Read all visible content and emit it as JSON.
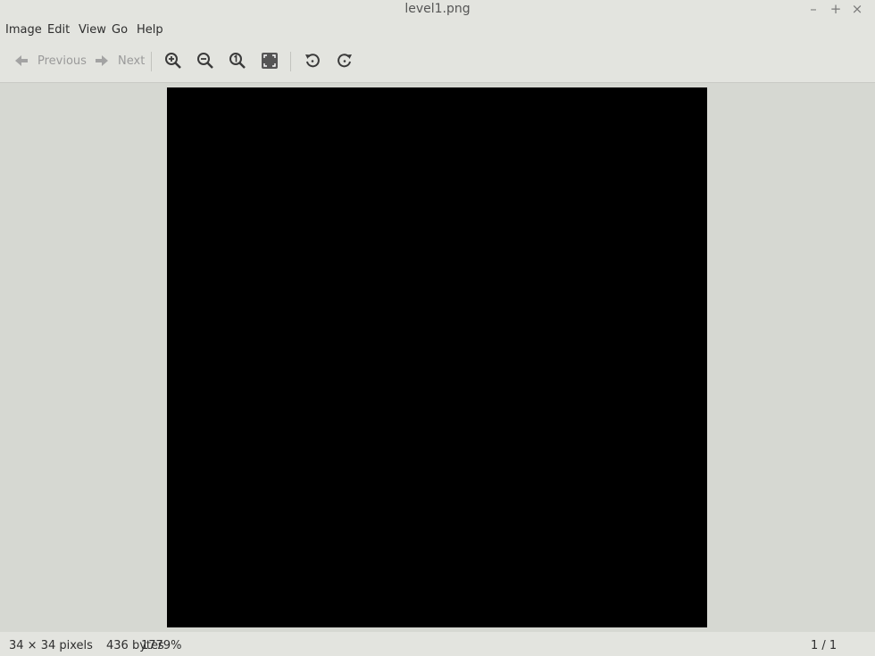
{
  "window": {
    "title": "level1.png",
    "controls": {
      "minimize": "–",
      "maximize": "+",
      "close": "×"
    }
  },
  "menu": [
    "Image",
    "Edit",
    "View",
    "Go",
    "Help"
  ],
  "toolbar": {
    "previous_label": "Previous",
    "next_label": "Next",
    "icons": [
      "arrow-left-icon",
      "arrow-right-icon",
      "zoom-in-icon",
      "zoom-out-icon",
      "zoom-original-icon",
      "zoom-fit-icon",
      "rotate-left-icon",
      "rotate-right-icon"
    ]
  },
  "image": {
    "maze": [
      "0000000000000000000000000000000000",
      "0000000000000000000000000000000000",
      "0000000000000000000000000000000000",
      "0000000000000000000000000000000000",
      "0000000000000000000000000000000000",
      "0000000000000000000000000000000000",
      "0000000000000000000000000000000000",
      "0000000000000000000000000000000000",
      "0000000000000000000000000000000000",
      "0000000000000000000000000000000000",
      "0000000000000000000000000000000000",
      "0000000000000000000000000000000000",
      "0000000000000000000000000000000000",
      "0000000000000000000000000000000000",
      "0000000000000000000000000000000000",
      "0000000000000000000000000000000000",
      "0000000000000000000000000000000000",
      "0000000000000000000000000000000000",
      "0000000000000000000000000000000000",
      "0000000000000000000000000000000000",
      "0000000000000000000000000000000000",
      "0000000000000000000000000000000000",
      "0000000000000000000000000000000000",
      "0000000000000000000000000000000000",
      "0000000000000000000000000000000000",
      "0000000000000000000000000000000000",
      "0000000000000000000000000000000000",
      "0000000000000000000000000000000000",
      "0000000000000000000000000000000000",
      "0000000000000000000000000000000000",
      "0000000000000000000000000000000000",
      "0000000000000000000000000000000000",
      "0000000000000000000000000000000000",
      "0000000000000000000000000000000000"
    ]
  },
  "status": {
    "dimensions": "34 × 34 pixels",
    "size": "436 bytes",
    "zoom": "1779%",
    "page": "1 / 1"
  }
}
